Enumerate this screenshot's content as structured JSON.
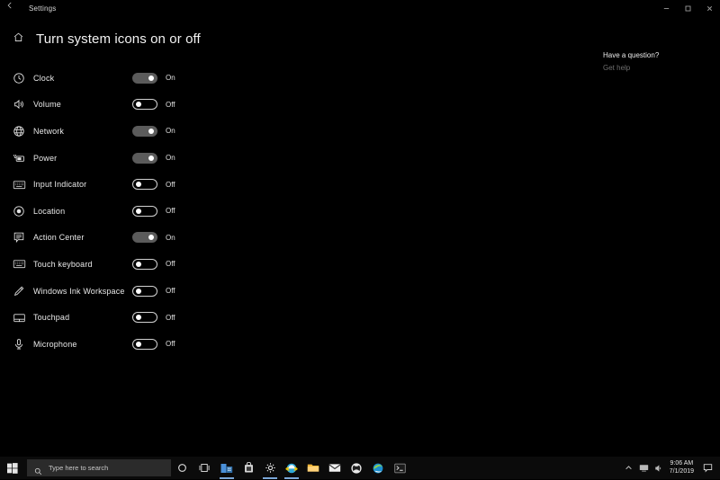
{
  "window": {
    "app_title": "Settings",
    "back_icon": "back-arrow-icon",
    "controls": [
      {
        "name": "minimize-button",
        "glyph": "minimize-icon"
      },
      {
        "name": "maximize-button",
        "glyph": "maximize-icon"
      },
      {
        "name": "close-button",
        "glyph": "close-icon"
      }
    ]
  },
  "page": {
    "home_icon": "home-icon",
    "title": "Turn system icons on or off"
  },
  "icon_list": [
    {
      "icon": "clock-icon",
      "label": "Clock",
      "state": "On"
    },
    {
      "icon": "volume-icon",
      "label": "Volume",
      "state": "Off"
    },
    {
      "icon": "network-globe-icon",
      "label": "Network",
      "state": "On"
    },
    {
      "icon": "power-battery-icon",
      "label": "Power",
      "state": "On"
    },
    {
      "icon": "keyboard-icon",
      "label": "Input Indicator",
      "state": "Off"
    },
    {
      "icon": "location-icon",
      "label": "Location",
      "state": "Off"
    },
    {
      "icon": "action-center-icon",
      "label": "Action Center",
      "state": "On"
    },
    {
      "icon": "touch-keyboard-icon",
      "label": "Touch keyboard",
      "state": "Off"
    },
    {
      "icon": "pen-ink-icon",
      "label": "Windows Ink Workspace",
      "state": "Off"
    },
    {
      "icon": "touchpad-icon",
      "label": "Touchpad",
      "state": "Off"
    },
    {
      "icon": "microphone-icon",
      "label": "Microphone",
      "state": "Off"
    }
  ],
  "help": {
    "heading": "Have a question?",
    "link": "Get help"
  },
  "taskbar": {
    "start_icon": "windows-start-icon",
    "search": {
      "placeholder": "Type here to search",
      "icon": "search-icon"
    },
    "cortana_icon": "cortana-circle-icon",
    "taskview_icon": "task-view-icon",
    "apps": [
      {
        "name": "store-pinned-icon",
        "active": true
      },
      {
        "name": "store-bag-icon",
        "active": false
      },
      {
        "name": "settings-gear-icon",
        "active": true
      },
      {
        "name": "internet-explorer-icon",
        "active": true
      },
      {
        "name": "file-explorer-icon",
        "active": false
      },
      {
        "name": "mail-icon",
        "active": false
      },
      {
        "name": "xbox-icon",
        "active": false
      },
      {
        "name": "edge-icon",
        "active": false
      },
      {
        "name": "command-prompt-icon",
        "active": false
      }
    ],
    "tray": [
      {
        "name": "show-hidden-icons-chevron-icon"
      },
      {
        "name": "network-tray-icon"
      },
      {
        "name": "volume-tray-icon"
      }
    ],
    "clock": {
      "time": "9:06 AM",
      "date": "7/1/2019"
    },
    "action_center_icon": "action-center-tray-icon"
  },
  "colors": {
    "background": "#000000",
    "toggle_on": "#5b5b5b",
    "toggle_border": "#d2d2d2",
    "taskbar": "#0b0b0b",
    "accent": "#7aa7d8"
  }
}
